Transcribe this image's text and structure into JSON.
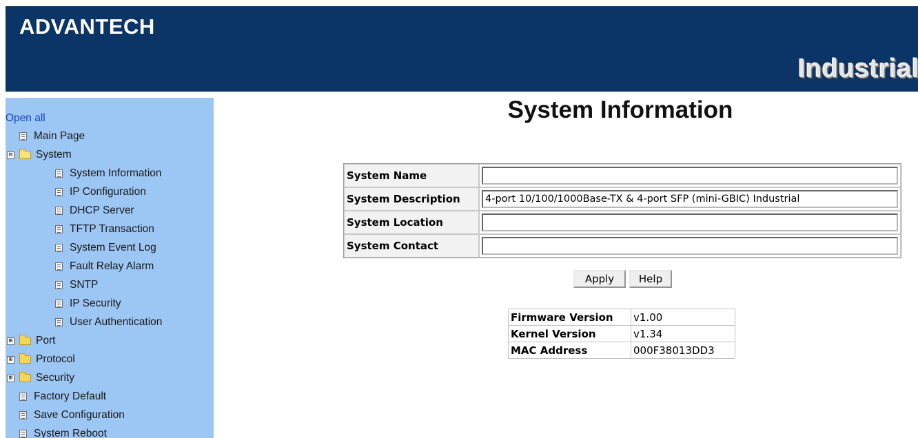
{
  "header": {
    "brand": "ADVANTECH",
    "tagline": "Industrial",
    "colors": {
      "banner": "#0b3566",
      "sidebar": "#9cc6f4"
    }
  },
  "sidebar": {
    "open_all": "Open all",
    "items": [
      {
        "label": "Main Page",
        "icon": "document-icon",
        "level": 1
      },
      {
        "label": "System",
        "icon": "folder-open-icon",
        "toggle": "⊟",
        "level": 1
      },
      {
        "label": "System Information",
        "icon": "document-icon",
        "level": 2
      },
      {
        "label": "IP Configuration",
        "icon": "document-icon",
        "level": 2
      },
      {
        "label": "DHCP Server",
        "icon": "document-icon",
        "level": 2
      },
      {
        "label": "TFTP Transaction",
        "icon": "document-icon",
        "level": 2
      },
      {
        "label": "System Event Log",
        "icon": "document-icon",
        "level": 2
      },
      {
        "label": "Fault Relay Alarm",
        "icon": "document-icon",
        "level": 2
      },
      {
        "label": "SNTP",
        "icon": "document-icon",
        "level": 2
      },
      {
        "label": "IP Security",
        "icon": "document-icon",
        "level": 2
      },
      {
        "label": "User Authentication",
        "icon": "document-icon",
        "level": 2
      },
      {
        "label": "Port",
        "icon": "folder-icon",
        "toggle": "⊞",
        "level": 1
      },
      {
        "label": "Protocol",
        "icon": "folder-icon",
        "toggle": "⊞",
        "level": 1
      },
      {
        "label": "Security",
        "icon": "folder-icon",
        "toggle": "⊞",
        "level": 1
      },
      {
        "label": "Factory Default",
        "icon": "document-icon",
        "level": 1
      },
      {
        "label": "Save Configuration",
        "icon": "document-icon",
        "level": 1
      },
      {
        "label": "System Reboot",
        "icon": "document-icon",
        "level": 1
      }
    ]
  },
  "main": {
    "title": "System Information",
    "form": {
      "name_label": "System Name",
      "name_value": "",
      "description_label": "System Description",
      "description_value": "4-port 10/100/1000Base-TX & 4-port SFP (mini-GBIC) Industrial",
      "location_label": "System Location",
      "location_value": "",
      "contact_label": "System Contact",
      "contact_value": ""
    },
    "buttons": {
      "apply": "Apply",
      "help": "Help"
    },
    "versions": {
      "firmware_label": "Firmware Version",
      "firmware_value": "v1.00",
      "kernel_label": "Kernel Version",
      "kernel_value": "v1.34",
      "mac_label": "MAC Address",
      "mac_value": "000F38013DD3"
    }
  }
}
